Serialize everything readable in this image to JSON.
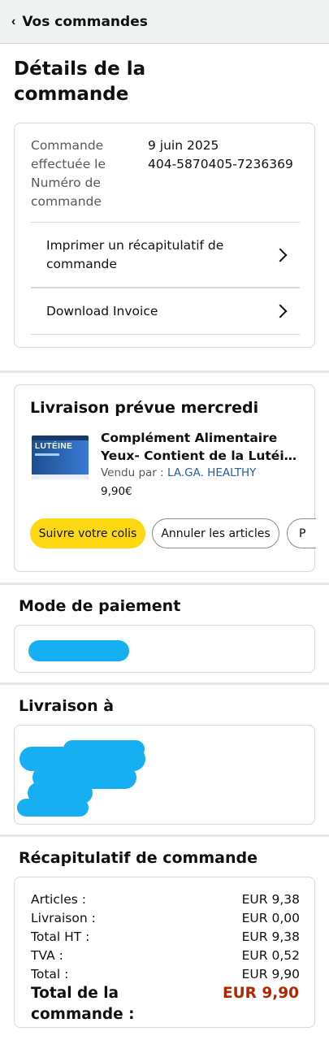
{
  "header": {
    "back_glyph": "‹",
    "title": "Vos commandes"
  },
  "page_title": "Détails de la commande",
  "order": {
    "date_label": "Commande effectuée le",
    "date_value": "9 juin 2025",
    "number_label": "Numéro de commande",
    "number_value": "404-5870405-7236369",
    "links": [
      "Imprimer un récapitulatif de commande",
      "Download Invoice"
    ]
  },
  "delivery": {
    "heading": "Livraison prévue mercredi",
    "product": {
      "title_line1": "Complément Alimentaire",
      "title_line2": "Yeux- Contient de la Lutéine...",
      "sold_by_label": "Vendu par :",
      "seller": "LA.GA. HEALTHY",
      "price": "9,90€",
      "image_text": "LUTÉINE"
    },
    "buttons": [
      "Suivre votre colis",
      "Annuler les articles",
      "P"
    ]
  },
  "payment": {
    "heading": "Mode de paiement"
  },
  "shipping": {
    "heading": "Livraison à"
  },
  "summary": {
    "heading": "Récapitulatif de commande",
    "rows": [
      {
        "label": "Articles :",
        "value": "EUR 9,38"
      },
      {
        "label": "Livraison :",
        "value": "EUR 0,00"
      },
      {
        "label": "Total HT :",
        "value": "EUR 9,38"
      },
      {
        "label": "TVA :",
        "value": "EUR 0,52"
      },
      {
        "label": "Total :",
        "value": "EUR 9,90"
      }
    ],
    "grand_total_label": "Total de la commande :",
    "grand_total_value": "EUR 9,90"
  },
  "colors": {
    "accent_button": "#ffd814",
    "price_red": "#b12704",
    "link_blue": "#2162a1",
    "redaction": "#16b0f2"
  }
}
